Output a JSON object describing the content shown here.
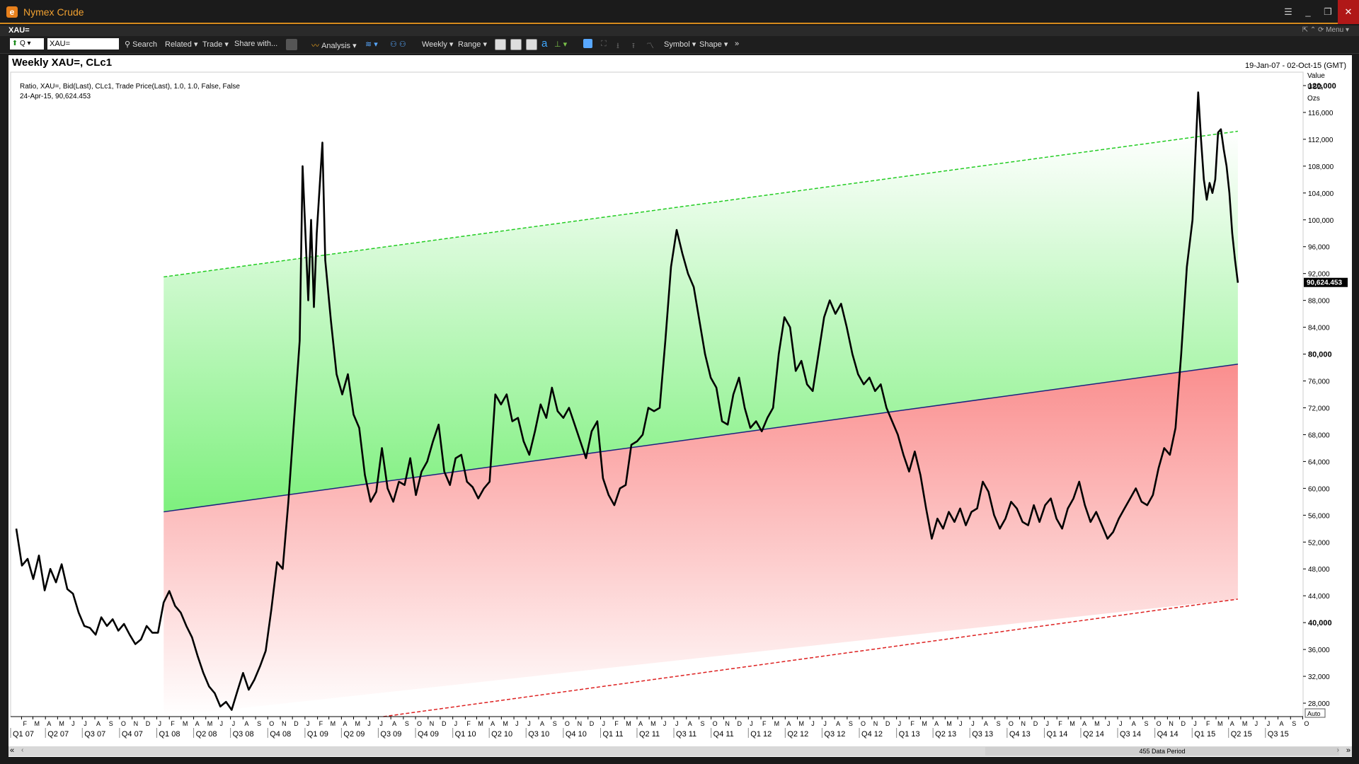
{
  "window": {
    "title": "Nymex Crude",
    "app_icon": "app-icon"
  },
  "ribbon": {
    "ric_label": "XAU=",
    "menu_label": "Menu"
  },
  "toolbar": {
    "ric_input": "XAU=",
    "mode_label": "Q",
    "search": "Search",
    "related": "Related",
    "trade": "Trade",
    "share": "Share with...",
    "analysis": "Analysis",
    "interval": "Weekly",
    "range": "Range",
    "symbol": "Symbol",
    "shape": "Shape"
  },
  "header": {
    "title": "Weekly XAU=, CLc1",
    "date_range": "19-Jan-07 - 02-Oct-15 (GMT)"
  },
  "legend": {
    "line1": "Ratio, XAU=, Bid(Last), CLc1, Trade Price(Last),  1.0, 1.0, False, False",
    "line2": "24-Apr-15, 90,624.453"
  },
  "axis": {
    "units": [
      "Value",
      "USD",
      "Ozs"
    ],
    "last_value_label": "90,624.453",
    "auto_label": "Auto",
    "data_period_label": "455 Data Period"
  },
  "colors": {
    "upper_band_line": "#22cc22",
    "lower_band_line": "#dd2020",
    "mid_line": "#1a237e",
    "upper_fill": "#8cf08c",
    "lower_fill": "#fa9090",
    "price_line": "#000000"
  },
  "chart_data": {
    "type": "line",
    "title": "Weekly XAU=, CLc1",
    "series": [
      {
        "name": "Ratio, XAU=, Bid(Last), CLc1, Trade Price(Last)",
        "points": [
          [
            "2007-01-19",
            54000
          ],
          [
            "2007-02-02",
            48500
          ],
          [
            "2007-02-16",
            49500
          ],
          [
            "2007-03-02",
            46500
          ],
          [
            "2007-03-16",
            50000
          ],
          [
            "2007-03-30",
            44800
          ],
          [
            "2007-04-13",
            48000
          ],
          [
            "2007-04-27",
            46000
          ],
          [
            "2007-05-11",
            48700
          ],
          [
            "2007-05-25",
            45000
          ],
          [
            "2007-06-08",
            44300
          ],
          [
            "2007-06-22",
            41500
          ],
          [
            "2007-07-06",
            39500
          ],
          [
            "2007-07-20",
            39200
          ],
          [
            "2007-08-03",
            38200
          ],
          [
            "2007-08-17",
            40800
          ],
          [
            "2007-08-31",
            39500
          ],
          [
            "2007-09-14",
            40500
          ],
          [
            "2007-09-28",
            38800
          ],
          [
            "2007-10-12",
            39800
          ],
          [
            "2007-10-26",
            38200
          ],
          [
            "2007-11-09",
            36800
          ],
          [
            "2007-11-23",
            37500
          ],
          [
            "2007-12-07",
            39500
          ],
          [
            "2007-12-21",
            38500
          ],
          [
            "2008-01-04",
            38500
          ],
          [
            "2008-01-18",
            43000
          ],
          [
            "2008-02-01",
            44700
          ],
          [
            "2008-02-15",
            42500
          ],
          [
            "2008-02-29",
            41500
          ],
          [
            "2008-03-14",
            39500
          ],
          [
            "2008-03-28",
            37800
          ],
          [
            "2008-04-11",
            35000
          ],
          [
            "2008-04-25",
            32500
          ],
          [
            "2008-05-09",
            30500
          ],
          [
            "2008-05-23",
            29500
          ],
          [
            "2008-06-06",
            27500
          ],
          [
            "2008-06-20",
            28200
          ],
          [
            "2008-07-04",
            27000
          ],
          [
            "2008-07-18",
            29800
          ],
          [
            "2008-08-01",
            32500
          ],
          [
            "2008-08-15",
            30000
          ],
          [
            "2008-08-29",
            31500
          ],
          [
            "2008-09-12",
            33500
          ],
          [
            "2008-09-26",
            35800
          ],
          [
            "2008-10-10",
            42000
          ],
          [
            "2008-10-24",
            49000
          ],
          [
            "2008-11-07",
            48000
          ],
          [
            "2008-11-21",
            58000
          ],
          [
            "2008-12-05",
            70000
          ],
          [
            "2008-12-19",
            82000
          ],
          [
            "2008-12-26",
            108000
          ],
          [
            "2009-01-09",
            88000
          ],
          [
            "2009-01-16",
            100000
          ],
          [
            "2009-01-23",
            87000
          ],
          [
            "2009-01-30",
            98000
          ],
          [
            "2009-02-13",
            111500
          ],
          [
            "2009-02-20",
            94000
          ],
          [
            "2009-03-06",
            85000
          ],
          [
            "2009-03-20",
            77000
          ],
          [
            "2009-04-03",
            74000
          ],
          [
            "2009-04-17",
            77000
          ],
          [
            "2009-05-01",
            71000
          ],
          [
            "2009-05-15",
            69000
          ],
          [
            "2009-05-29",
            62000
          ],
          [
            "2009-06-12",
            58000
          ],
          [
            "2009-06-26",
            59500
          ],
          [
            "2009-07-10",
            66000
          ],
          [
            "2009-07-24",
            60000
          ],
          [
            "2009-08-07",
            58000
          ],
          [
            "2009-08-21",
            61000
          ],
          [
            "2009-09-04",
            60500
          ],
          [
            "2009-09-18",
            64500
          ],
          [
            "2009-10-02",
            59000
          ],
          [
            "2009-10-16",
            62500
          ],
          [
            "2009-10-30",
            64000
          ],
          [
            "2009-11-13",
            67000
          ],
          [
            "2009-11-27",
            69500
          ],
          [
            "2009-12-11",
            62500
          ],
          [
            "2009-12-25",
            60500
          ],
          [
            "2010-01-08",
            64500
          ],
          [
            "2010-01-22",
            65000
          ],
          [
            "2010-02-05",
            61000
          ],
          [
            "2010-02-19",
            60200
          ],
          [
            "2010-03-05",
            58500
          ],
          [
            "2010-03-19",
            60000
          ],
          [
            "2010-04-02",
            61000
          ],
          [
            "2010-04-16",
            74000
          ],
          [
            "2010-04-30",
            72500
          ],
          [
            "2010-05-14",
            74000
          ],
          [
            "2010-05-28",
            70000
          ],
          [
            "2010-06-11",
            70500
          ],
          [
            "2010-06-25",
            67000
          ],
          [
            "2010-07-09",
            65000
          ],
          [
            "2010-07-23",
            68500
          ],
          [
            "2010-08-06",
            72500
          ],
          [
            "2010-08-20",
            70500
          ],
          [
            "2010-09-03",
            75000
          ],
          [
            "2010-09-17",
            71500
          ],
          [
            "2010-10-01",
            70500
          ],
          [
            "2010-10-15",
            72000
          ],
          [
            "2010-10-29",
            69500
          ],
          [
            "2010-11-12",
            67000
          ],
          [
            "2010-11-26",
            64500
          ],
          [
            "2010-12-10",
            68500
          ],
          [
            "2010-12-24",
            70000
          ],
          [
            "2011-01-07",
            61500
          ],
          [
            "2011-01-21",
            59000
          ],
          [
            "2011-02-04",
            57500
          ],
          [
            "2011-02-18",
            60000
          ],
          [
            "2011-03-04",
            60500
          ],
          [
            "2011-03-18",
            66500
          ],
          [
            "2011-04-01",
            67000
          ],
          [
            "2011-04-15",
            68000
          ],
          [
            "2011-04-29",
            72000
          ],
          [
            "2011-05-13",
            71500
          ],
          [
            "2011-05-27",
            72000
          ],
          [
            "2011-06-10",
            82000
          ],
          [
            "2011-06-24",
            93000
          ],
          [
            "2011-07-08",
            98500
          ],
          [
            "2011-07-22",
            95000
          ],
          [
            "2011-08-05",
            92000
          ],
          [
            "2011-08-19",
            90000
          ],
          [
            "2011-09-02",
            85000
          ],
          [
            "2011-09-16",
            80000
          ],
          [
            "2011-09-30",
            76500
          ],
          [
            "2011-10-14",
            75000
          ],
          [
            "2011-10-28",
            70000
          ],
          [
            "2011-11-11",
            69500
          ],
          [
            "2011-11-25",
            74000
          ],
          [
            "2011-12-09",
            76500
          ],
          [
            "2011-12-23",
            72000
          ],
          [
            "2012-01-06",
            69000
          ],
          [
            "2012-01-20",
            70000
          ],
          [
            "2012-02-03",
            68500
          ],
          [
            "2012-02-17",
            70500
          ],
          [
            "2012-03-02",
            72000
          ],
          [
            "2012-03-16",
            80000
          ],
          [
            "2012-03-30",
            85500
          ],
          [
            "2012-04-13",
            84000
          ],
          [
            "2012-04-27",
            77500
          ],
          [
            "2012-05-11",
            79000
          ],
          [
            "2012-05-25",
            75500
          ],
          [
            "2012-06-08",
            74500
          ],
          [
            "2012-06-22",
            80000
          ],
          [
            "2012-07-06",
            85500
          ],
          [
            "2012-07-20",
            88000
          ],
          [
            "2012-08-03",
            86000
          ],
          [
            "2012-08-17",
            87500
          ],
          [
            "2012-08-31",
            84000
          ],
          [
            "2012-09-14",
            80000
          ],
          [
            "2012-09-28",
            77000
          ],
          [
            "2012-10-12",
            75500
          ],
          [
            "2012-10-26",
            76500
          ],
          [
            "2012-11-09",
            74500
          ],
          [
            "2012-11-23",
            75500
          ],
          [
            "2012-12-07",
            72000
          ],
          [
            "2012-12-21",
            70000
          ],
          [
            "2013-01-04",
            68000
          ],
          [
            "2013-01-18",
            65000
          ],
          [
            "2013-02-01",
            62500
          ],
          [
            "2013-02-15",
            65500
          ],
          [
            "2013-03-01",
            62000
          ],
          [
            "2013-03-15",
            57000
          ],
          [
            "2013-03-29",
            52500
          ],
          [
            "2013-04-12",
            55500
          ],
          [
            "2013-04-26",
            54000
          ],
          [
            "2013-05-10",
            56500
          ],
          [
            "2013-05-24",
            55000
          ],
          [
            "2013-06-07",
            57000
          ],
          [
            "2013-06-21",
            54500
          ],
          [
            "2013-07-05",
            56500
          ],
          [
            "2013-07-19",
            57000
          ],
          [
            "2013-08-02",
            61000
          ],
          [
            "2013-08-16",
            59500
          ],
          [
            "2013-08-30",
            56000
          ],
          [
            "2013-09-13",
            54000
          ],
          [
            "2013-09-27",
            55500
          ],
          [
            "2013-10-11",
            58000
          ],
          [
            "2013-10-25",
            57000
          ],
          [
            "2013-11-08",
            55000
          ],
          [
            "2013-11-22",
            54500
          ],
          [
            "2013-12-06",
            57500
          ],
          [
            "2013-12-20",
            55000
          ],
          [
            "2014-01-03",
            57500
          ],
          [
            "2014-01-17",
            58500
          ],
          [
            "2014-01-31",
            55500
          ],
          [
            "2014-02-14",
            54000
          ],
          [
            "2014-02-28",
            57000
          ],
          [
            "2014-03-14",
            58500
          ],
          [
            "2014-03-28",
            61000
          ],
          [
            "2014-04-11",
            57500
          ],
          [
            "2014-04-25",
            55000
          ],
          [
            "2014-05-09",
            56500
          ],
          [
            "2014-05-23",
            54500
          ],
          [
            "2014-06-06",
            52500
          ],
          [
            "2014-06-20",
            53500
          ],
          [
            "2014-07-04",
            55500
          ],
          [
            "2014-07-18",
            57000
          ],
          [
            "2014-08-01",
            58500
          ],
          [
            "2014-08-15",
            60000
          ],
          [
            "2014-08-29",
            58000
          ],
          [
            "2014-09-12",
            57500
          ],
          [
            "2014-09-26",
            59000
          ],
          [
            "2014-10-10",
            63000
          ],
          [
            "2014-10-24",
            66000
          ],
          [
            "2014-11-07",
            65000
          ],
          [
            "2014-11-21",
            69000
          ],
          [
            "2014-12-05",
            80000
          ],
          [
            "2014-12-19",
            93000
          ],
          [
            "2015-01-02",
            100000
          ],
          [
            "2015-01-16",
            119000
          ],
          [
            "2015-01-23",
            112000
          ],
          [
            "2015-01-30",
            106000
          ],
          [
            "2015-02-06",
            103000
          ],
          [
            "2015-02-13",
            105500
          ],
          [
            "2015-02-20",
            104000
          ],
          [
            "2015-02-27",
            106000
          ],
          [
            "2015-03-06",
            113000
          ],
          [
            "2015-03-13",
            113500
          ],
          [
            "2015-03-20",
            110500
          ],
          [
            "2015-03-27",
            108000
          ],
          [
            "2015-04-03",
            104000
          ],
          [
            "2015-04-10",
            98000
          ],
          [
            "2015-04-17",
            94000
          ],
          [
            "2015-04-24",
            90624.453
          ]
        ]
      }
    ],
    "channel": {
      "start_date": "2008-01-18",
      "end_date": "2015-04-24",
      "mid_start": 56500,
      "mid_end": 78500,
      "upper_start": 91500,
      "upper_end": 113200,
      "lower_start": 21500,
      "lower_end": 43500
    },
    "y_ticks": [
      28000,
      32000,
      36000,
      40000,
      44000,
      48000,
      52000,
      56000,
      60000,
      64000,
      68000,
      72000,
      76000,
      80000,
      84000,
      88000,
      92000,
      96000,
      100000,
      104000,
      108000,
      112000,
      116000,
      120000
    ],
    "y_tick_labels": [
      "28,000",
      "32,000",
      "36,000",
      "40,000",
      "44,000",
      "48,000",
      "52,000",
      "56,000",
      "60,000",
      "64,000",
      "68,000",
      "72,000",
      "76,000",
      "80,000",
      "84,000",
      "88,000",
      "92,000",
      "96,000",
      "100,000",
      "104,000",
      "108,000",
      "112,000",
      "116,000",
      "120,000"
    ],
    "y_bold_ticks": [
      40000,
      80000,
      120000
    ],
    "ylim": [
      26000,
      122000
    ],
    "xlim": [
      "2007-01-05",
      "2015-10-02"
    ],
    "month_letters": [
      "F",
      "M",
      "A",
      "M",
      "J",
      "J",
      "A",
      "S",
      "O",
      "N",
      "D",
      "J",
      "F",
      "M",
      "A",
      "M",
      "J",
      "J",
      "A",
      "S",
      "O",
      "N",
      "D",
      "J",
      "F",
      "M",
      "A",
      "M",
      "J",
      "J",
      "A",
      "S",
      "O",
      "N",
      "D",
      "J",
      "F",
      "M",
      "A",
      "M",
      "J",
      "J",
      "A",
      "S",
      "O",
      "N",
      "D",
      "J",
      "F",
      "M",
      "A",
      "M",
      "J",
      "J",
      "A",
      "S",
      "O",
      "N",
      "D",
      "J",
      "F",
      "M",
      "A",
      "M",
      "J",
      "J",
      "A",
      "S",
      "O",
      "N",
      "D",
      "J",
      "F",
      "M",
      "A",
      "M",
      "J",
      "J",
      "A",
      "S",
      "O",
      "N",
      "D",
      "J",
      "F",
      "M",
      "A",
      "M",
      "J",
      "J",
      "A",
      "S",
      "O",
      "N",
      "D",
      "J",
      "F",
      "M",
      "A",
      "M",
      "J",
      "J",
      "A",
      "S",
      "O"
    ],
    "quarter_labels": [
      "Q1 07",
      "Q2 07",
      "Q3 07",
      "Q4 07",
      "Q1 08",
      "Q2 08",
      "Q3 08",
      "Q4 08",
      "Q1 09",
      "Q2 09",
      "Q3 09",
      "Q4 09",
      "Q1 10",
      "Q2 10",
      "Q3 10",
      "Q4 10",
      "Q1 11",
      "Q2 11",
      "Q3 11",
      "Q4 11",
      "Q1 12",
      "Q2 12",
      "Q3 12",
      "Q4 12",
      "Q1 13",
      "Q2 13",
      "Q3 13",
      "Q4 13",
      "Q1 14",
      "Q2 14",
      "Q3 14",
      "Q4 14",
      "Q1 15",
      "Q2 15",
      "Q3 15"
    ]
  }
}
